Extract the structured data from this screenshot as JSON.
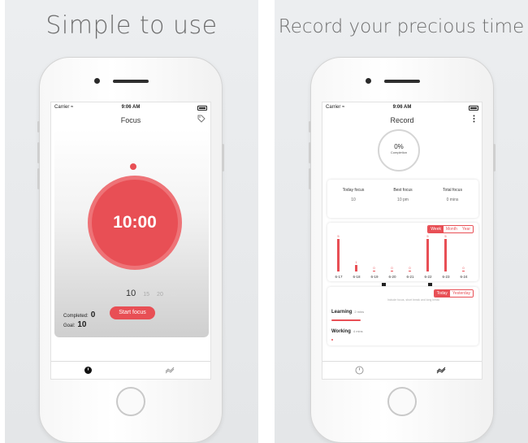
{
  "left": {
    "headline": "Simple to use",
    "status": {
      "carrier": "Carrier ≈",
      "time": "9:06 AM"
    },
    "nav": {
      "title": "Focus",
      "icon": "tag-icon"
    },
    "timer": "10:00",
    "picker": [
      "10",
      "15",
      "20",
      "25"
    ],
    "start_label": "Start focus",
    "completed_label": "Completed:",
    "completed_value": "0",
    "goal_label": "Goal:",
    "goal_value": "10",
    "tabs": [
      "timer-icon",
      "chart-icon"
    ]
  },
  "right": {
    "headline": "Record your precious time",
    "status": {
      "carrier": "Carrier ≈",
      "time": "9:06 AM"
    },
    "nav": {
      "title": "Record",
      "icon": "more-icon"
    },
    "gauge": {
      "value": "0%",
      "caption": "Completion"
    },
    "stats": [
      {
        "label": "Today focus",
        "value": "10"
      },
      {
        "label": "Best focus",
        "value": "10 pm"
      },
      {
        "label": "Total focus",
        "value": "0 mins"
      }
    ],
    "ranges": [
      "Week",
      "Month",
      "Year"
    ],
    "selected_range": "Week",
    "chart_data": {
      "type": "bar",
      "categories": [
        "6-17",
        "6-18",
        "6-19",
        "6-20",
        "6-21",
        "6-22",
        "6-23",
        "6-24"
      ],
      "values": [
        5,
        1,
        0,
        0,
        0,
        5,
        5,
        0
      ],
      "ylim": [
        0,
        5
      ]
    },
    "days": [
      "Today",
      "Yesterday"
    ],
    "hint": "Include focus, short break and long break",
    "categories": [
      {
        "name": "Learning",
        "minutes": "2 mins",
        "fill": 0.24
      },
      {
        "name": "Working",
        "minutes": "4 mins",
        "fill": 0.01
      }
    ],
    "tabs": [
      "timer-icon",
      "chart-icon"
    ],
    "accent": "#e84f55"
  }
}
